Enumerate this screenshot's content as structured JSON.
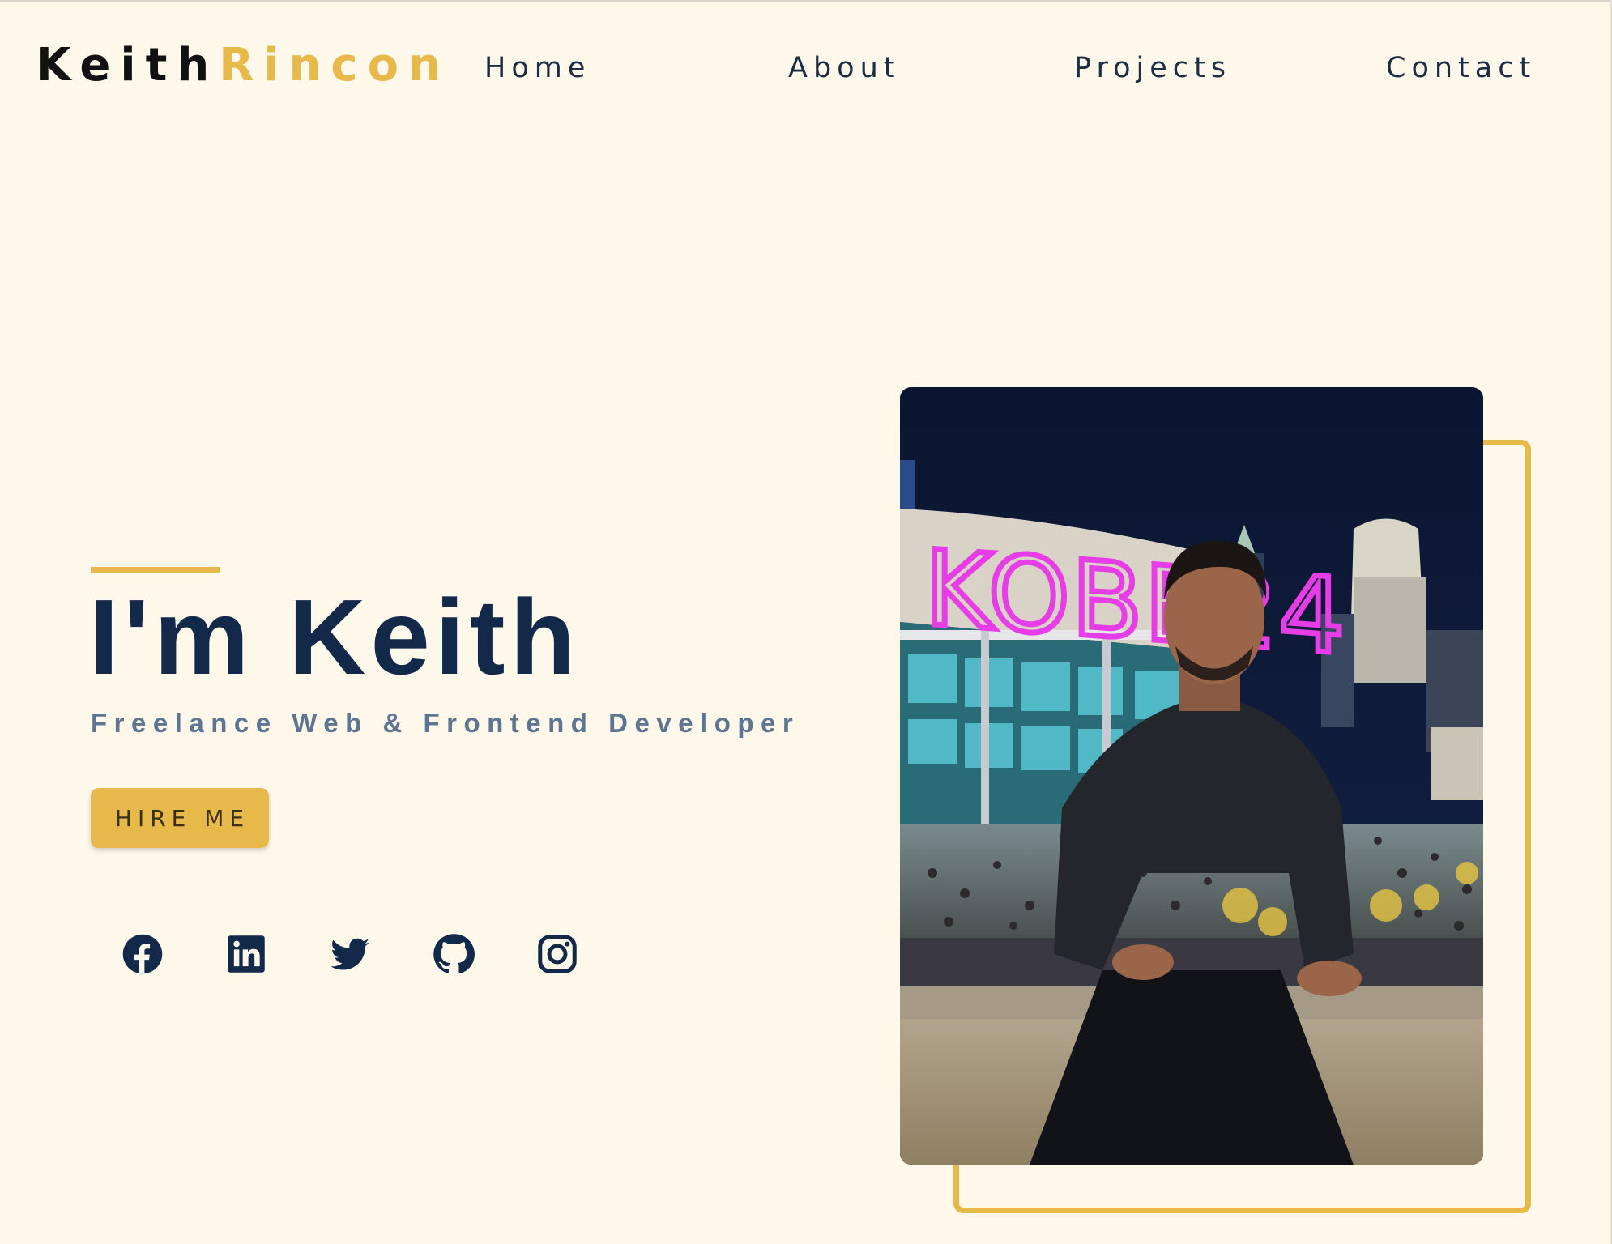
{
  "brand": {
    "first": "Keith",
    "last": "Rincon"
  },
  "nav": {
    "home": "Home",
    "about": "About",
    "projects": "Projects",
    "contact": "Contact"
  },
  "hero": {
    "title": "I'm Keith",
    "subtitle": "Freelance Web & Frontend Developer",
    "cta_label": "HIRE ME"
  },
  "socials": [
    {
      "name": "facebook",
      "icon": "facebook-icon"
    },
    {
      "name": "linkedin",
      "icon": "linkedin-icon"
    },
    {
      "name": "twitter",
      "icon": "twitter-icon"
    },
    {
      "name": "github",
      "icon": "github-icon"
    },
    {
      "name": "instagram",
      "icon": "instagram-icon"
    }
  ],
  "photo": {
    "sign_text": "KOBE24"
  },
  "colors": {
    "background": "#fef8eb",
    "accent": "#e7b84a",
    "navy": "#12294a",
    "subtitle": "#5d7590"
  }
}
